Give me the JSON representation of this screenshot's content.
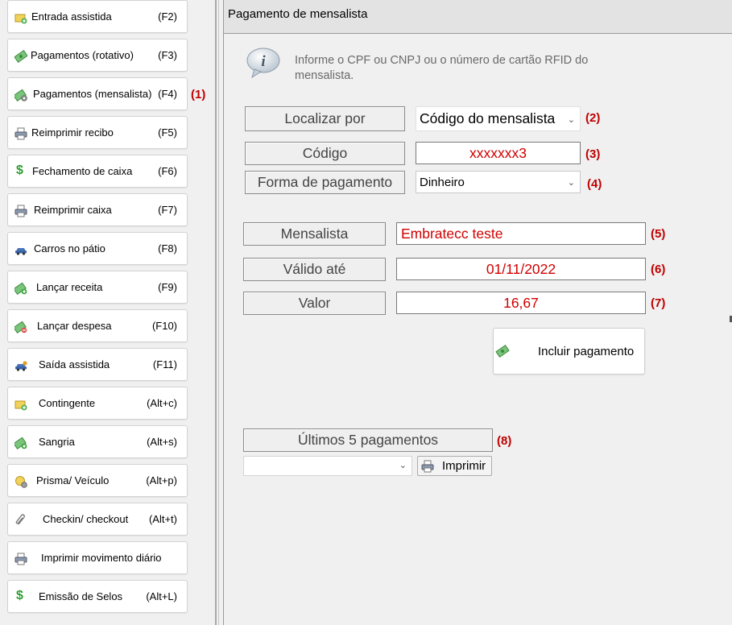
{
  "sidebar": {
    "items": [
      {
        "label": "Entrada assistida",
        "shortcut": "(F2)",
        "icon": "ticket-add-icon"
      },
      {
        "label": "Pagamentos (rotativo)",
        "shortcut": "(F3)",
        "icon": "money-icon"
      },
      {
        "label": "Pagamentos (mensalista)",
        "shortcut": "(F4)",
        "icon": "money-gear-icon"
      },
      {
        "label": "Reimprimir recibo",
        "shortcut": "(F5)",
        "icon": "printer-icon"
      },
      {
        "label": "Fechamento de caixa",
        "shortcut": "(F6)",
        "icon": "dollar-icon"
      },
      {
        "label": "Reimprimir caixa",
        "shortcut": "(F7)",
        "icon": "printer-icon"
      },
      {
        "label": "Carros no pátio",
        "shortcut": "(F8)",
        "icon": "car-icon"
      },
      {
        "label": "Lançar receita",
        "shortcut": "(F9)",
        "icon": "money-add-icon"
      },
      {
        "label": "Lançar despesa",
        "shortcut": "(F10)",
        "icon": "money-remove-icon"
      },
      {
        "label": "Saída assistida",
        "shortcut": "(F11)",
        "icon": "car-exit-icon"
      },
      {
        "label": "Contingente",
        "shortcut": "(Alt+c)",
        "icon": "ticket-add-icon"
      },
      {
        "label": "Sangria",
        "shortcut": "(Alt+s)",
        "icon": "money-add-icon"
      },
      {
        "label": "Prisma/ Veículo",
        "shortcut": "(Alt+p)",
        "icon": "ticket-add-icon"
      },
      {
        "label": "Checkin/ checkout",
        "shortcut": "(Alt+t)",
        "icon": "paperclip-icon"
      },
      {
        "label": "Imprimir movimento diário",
        "shortcut": "",
        "icon": "printer-icon"
      },
      {
        "label": "Emissão de Selos",
        "shortcut": "(Alt+L)",
        "icon": "dollar-icon"
      }
    ],
    "annotation": "(1)"
  },
  "main": {
    "title": "Pagamento de mensalista",
    "info": "Informe o CPF ou CNPJ ou o número de cartão RFID do mensalista.",
    "localizar": {
      "label": "Localizar por",
      "value": "Código do mensalista",
      "annotation": "(2)"
    },
    "codigo": {
      "label": "Código",
      "value": "xxxxxxx3",
      "annotation": "(3)"
    },
    "forma": {
      "label": "Forma de pagamento",
      "value": "Dinheiro",
      "annotation": "(4)"
    },
    "mensalista": {
      "label": "Mensalista",
      "value": "Embratecc teste",
      "annotation": "(5)"
    },
    "valido": {
      "label": "Válido até",
      "value": "01/11/2022",
      "annotation": "(6)"
    },
    "valor": {
      "label": "Valor",
      "value": "16,67",
      "annotation": "(7)"
    },
    "incluir_label": "Incluir pagamento",
    "ultimos": {
      "label": "Últimos 5 pagamentos",
      "annotation": "(8)",
      "select_value": ""
    },
    "imprimir_label": "Imprimir"
  },
  "colors": {
    "annotation": "#c00000",
    "field_text": "#d00000",
    "money_green": "#3c9a3c",
    "dollar_green": "#2e9e2e"
  }
}
